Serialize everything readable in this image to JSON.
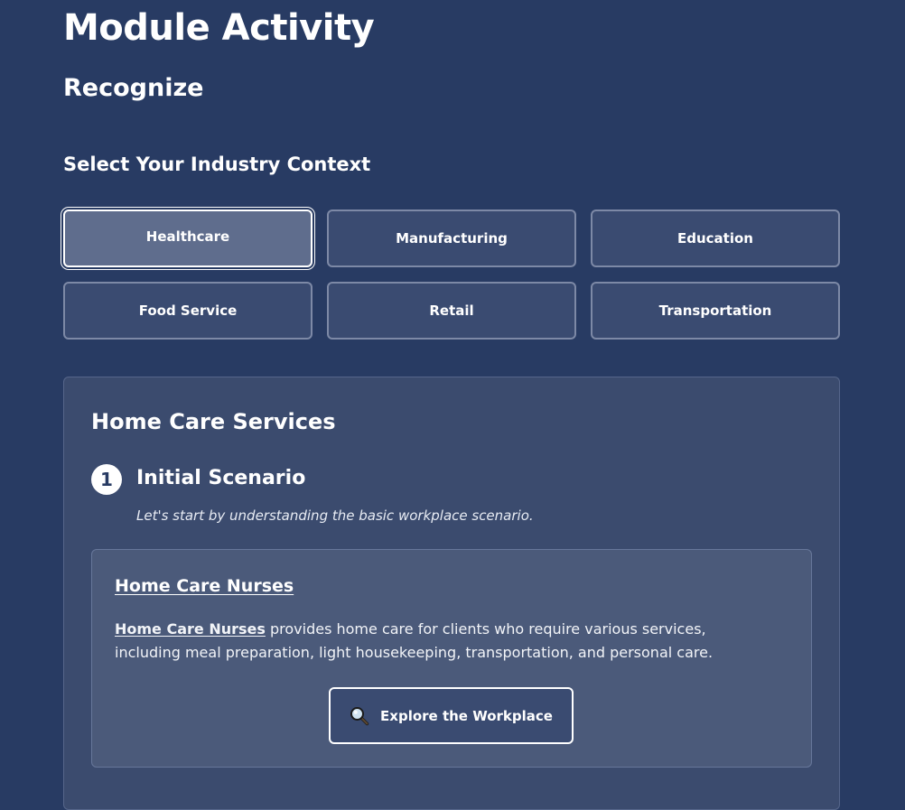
{
  "module": {
    "title": "Module Activity",
    "subtitle": "Recognize"
  },
  "industry_context": {
    "heading": "Select Your Industry Context",
    "selected": "Healthcare",
    "options": [
      {
        "label": "Healthcare"
      },
      {
        "label": "Manufacturing"
      },
      {
        "label": "Education"
      },
      {
        "label": "Food Service"
      },
      {
        "label": "Retail"
      },
      {
        "label": "Transportation"
      }
    ]
  },
  "scenario_card": {
    "title": "Home Care Services",
    "step": {
      "number": "1",
      "title": "Initial Scenario",
      "description": "Let's start by understanding the basic workplace scenario."
    },
    "company": {
      "name": "Home Care Nurses",
      "description_suffix": " provides home care for clients who require various services, including meal preparation, light housekeeping, transportation, and personal care.",
      "explore_button": {
        "label": "Explore the Workplace",
        "icon": "magnifying-glass-icon"
      }
    }
  },
  "colors": {
    "background": "#283b63",
    "card": "#3b4b6e",
    "inner_card": "#4b5a7a",
    "button": "#3a4b71",
    "selected_button": "#5f6d8d",
    "text": "#ffffff"
  }
}
